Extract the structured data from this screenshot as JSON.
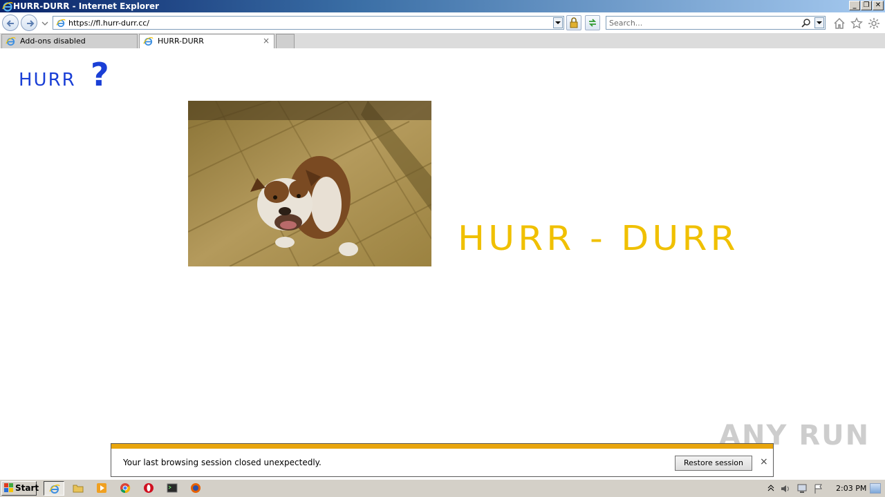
{
  "window": {
    "title": "HURR-DURR - Internet Explorer"
  },
  "address_bar": {
    "url": "https://fl.hurr-durr.cc/"
  },
  "search": {
    "placeholder": "Search..."
  },
  "tabs": [
    {
      "label": "Add-ons disabled",
      "active": false
    },
    {
      "label": "HURR-DURR",
      "active": true
    }
  ],
  "page": {
    "logo_text": "HURR",
    "logo_mark": "?",
    "hero_title": "HURR - DURR",
    "image_alt": "bulldog on tile floor",
    "colors": {
      "logo": "#1a3fd6",
      "hero": "#f0c000"
    }
  },
  "notification": {
    "message": "Your last browsing session closed unexpectedly.",
    "restore_label": "Restore session",
    "close_glyph": "×"
  },
  "watermark": "ANY RUN",
  "taskbar": {
    "start_label": "Start",
    "clock": "2:03 PM"
  }
}
